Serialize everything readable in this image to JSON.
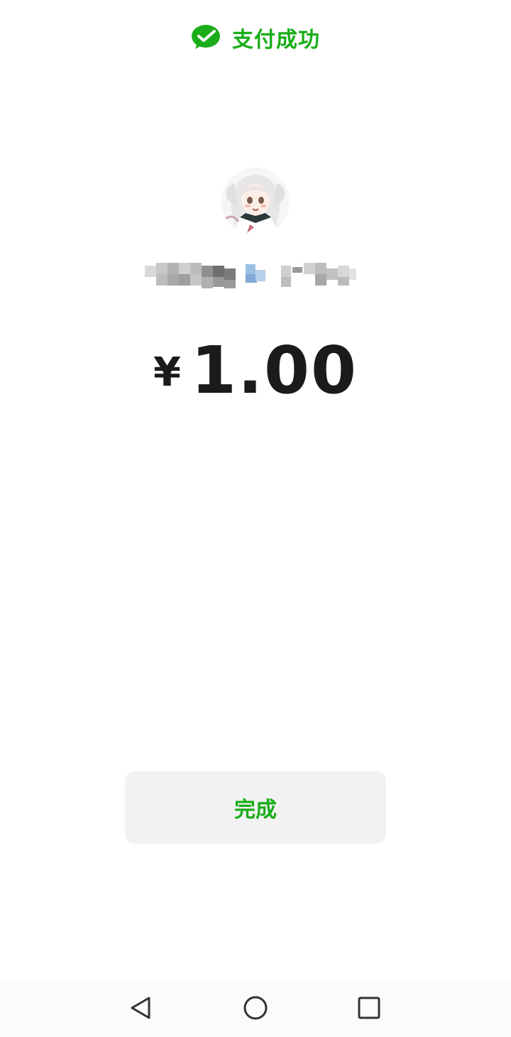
{
  "colors": {
    "accent": "#1aad19",
    "text_primary": "#1b1b1b",
    "button_bg": "#f2f2f2",
    "background": "#ffffff"
  },
  "header": {
    "icon": "wechat-pay-check-icon",
    "title": "支付成功"
  },
  "payee": {
    "avatar": "anime-avatar",
    "name": "",
    "name_obscured": true
  },
  "amount": {
    "currency": "¥",
    "value": "1.00"
  },
  "actions": {
    "done_label": "完成"
  },
  "navbar": {
    "back_icon": "back-triangle-icon",
    "home_icon": "home-circle-icon",
    "recents_icon": "recents-square-icon"
  }
}
